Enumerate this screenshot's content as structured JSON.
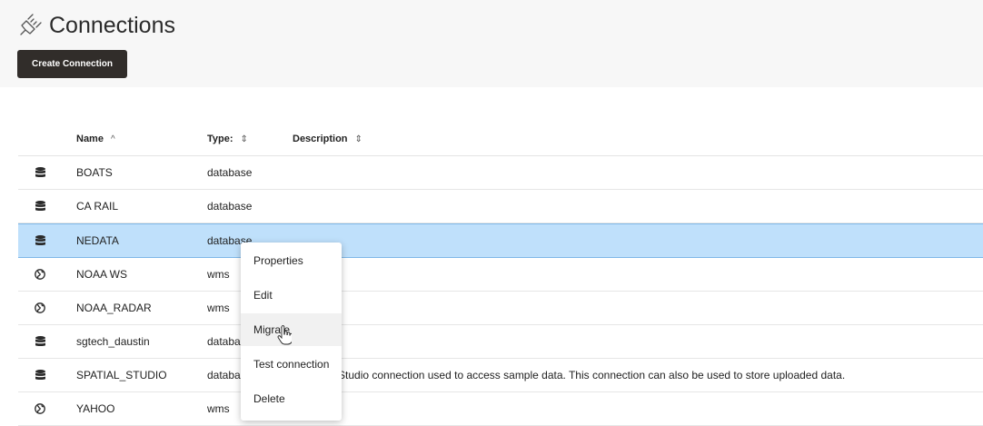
{
  "header": {
    "title": "Connections",
    "title_icon": "plug-icon",
    "create_button_label": "Create Connection"
  },
  "table": {
    "columns": [
      {
        "label": "Name",
        "sort": "ascending",
        "sort_glyph": "^"
      },
      {
        "label": "Type:",
        "sort": "none",
        "sort_glyph": "⇕"
      },
      {
        "label": "Description",
        "sort": "none",
        "sort_glyph": "⇕"
      }
    ],
    "rows": [
      {
        "icon": "database-icon",
        "name": "BOATS",
        "type": "database",
        "description": ""
      },
      {
        "icon": "database-icon",
        "name": "CA RAIL",
        "type": "database",
        "description": ""
      },
      {
        "icon": "database-icon",
        "name": "NEDATA",
        "type": "database",
        "description": "",
        "selected": true
      },
      {
        "icon": "globe-icon",
        "name": "NOAA WS",
        "type": "wms",
        "description": ""
      },
      {
        "icon": "globe-icon",
        "name": "NOAA_RADAR",
        "type": "wms",
        "description": ""
      },
      {
        "icon": "database-icon",
        "name": "sgtech_daustin",
        "type": "database",
        "description": ""
      },
      {
        "icon": "database-icon",
        "name": "SPATIAL_STUDIO",
        "type": "database",
        "description": "Spatial Studio connection used to access sample data. This connection can also be used to store uploaded data."
      },
      {
        "icon": "globe-icon",
        "name": "YAHOO",
        "type": "wms",
        "description": ""
      }
    ]
  },
  "context_menu": {
    "items": [
      "Properties",
      "Edit",
      "Migrate",
      "Test connection",
      "Delete"
    ],
    "hovered": "Migrate"
  },
  "colors": {
    "button_bg": "#312d2a",
    "selected_row": "#bfe0fb",
    "header_bg": "#f7f7f7"
  }
}
